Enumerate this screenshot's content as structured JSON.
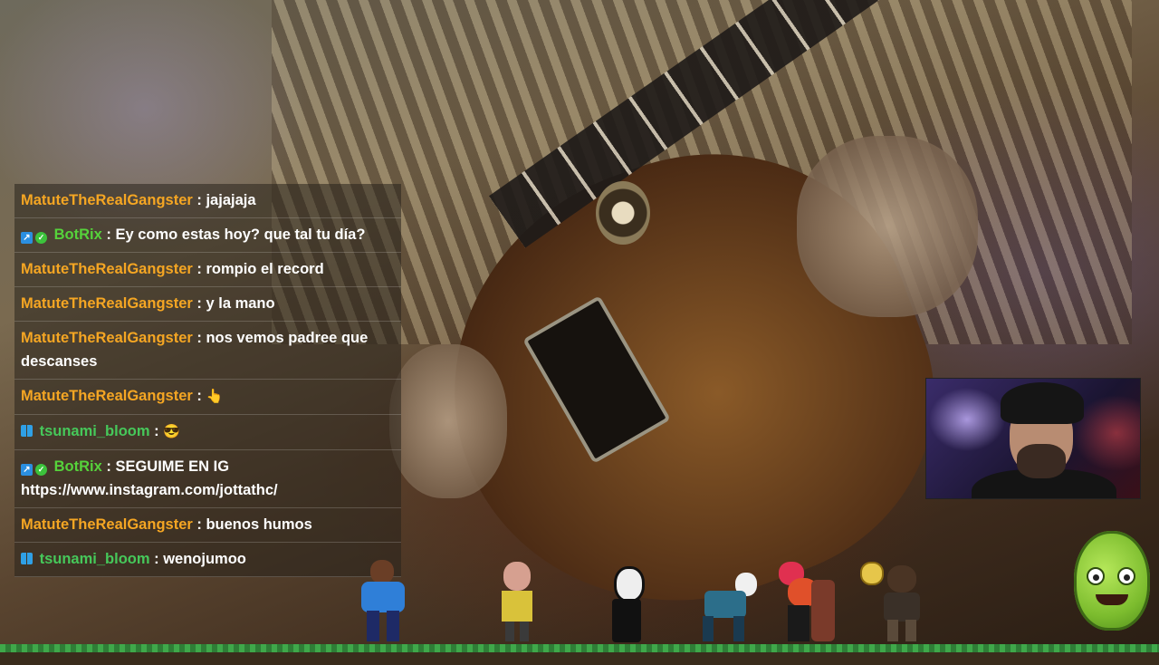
{
  "chat": {
    "messages": [
      {
        "user": "MatuteTheRealGangster",
        "sep": " : ",
        "text": "jajajaja"
      },
      {
        "user": "BotRix",
        "sep": " : ",
        "text": "Ey como estas hoy? que tal tu día?"
      },
      {
        "user": "MatuteTheRealGangster",
        "sep": " : ",
        "text": "rompio el record"
      },
      {
        "user": "MatuteTheRealGangster",
        "sep": " : ",
        "text": "y la mano"
      },
      {
        "user": "MatuteTheRealGangster",
        "sep": " : ",
        "text": "nos vemos padree que descanses"
      },
      {
        "user": "MatuteTheRealGangster",
        "sep": " : ",
        "text": "👆"
      },
      {
        "user": "tsunami_bloom",
        "sep": " : ",
        "text": "😎"
      },
      {
        "user": "BotRix",
        "sep": " : ",
        "text": "SEGUIME EN IG https://www.instagram.com/jottathc/"
      },
      {
        "user": "MatuteTheRealGangster",
        "sep": " : ",
        "text": "buenos humos"
      },
      {
        "user": "tsunami_bloom",
        "sep": " : ",
        "text": "wenojumoo"
      }
    ]
  },
  "colors": {
    "matute": "#f5a623",
    "botrix": "#56d33b",
    "tsunami": "#46c85a",
    "ground": "#3fa84a"
  },
  "icons": {
    "bot_badge": "bot-badge-icon",
    "verified_badge": "verified-check-icon",
    "sub_badge": "subscriber-badge-icon",
    "coin": "coin-icon"
  }
}
